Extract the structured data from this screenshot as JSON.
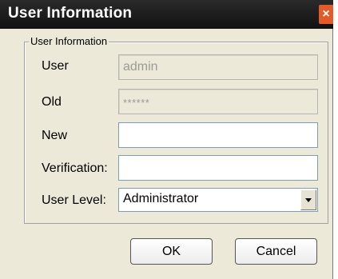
{
  "dialog": {
    "title": "User Information",
    "close_glyph": "×",
    "group_label": "User Information"
  },
  "fields": {
    "user": {
      "label": "User",
      "value": "admin"
    },
    "old": {
      "label": "Old",
      "value": "******"
    },
    "new": {
      "label": "New",
      "value": ""
    },
    "verification": {
      "label": "Verification:",
      "value": ""
    },
    "user_level": {
      "label": "User Level:",
      "selected": "Administrator"
    }
  },
  "buttons": {
    "ok_label": "OK",
    "cancel_label": "Cancel"
  },
  "icons": {
    "close": "close-icon",
    "dropdown": "chevron-down-icon"
  },
  "colors": {
    "titlebar": "#1c1c1c",
    "close": "#e35b28",
    "dialog_bg": "#ece9d8"
  }
}
